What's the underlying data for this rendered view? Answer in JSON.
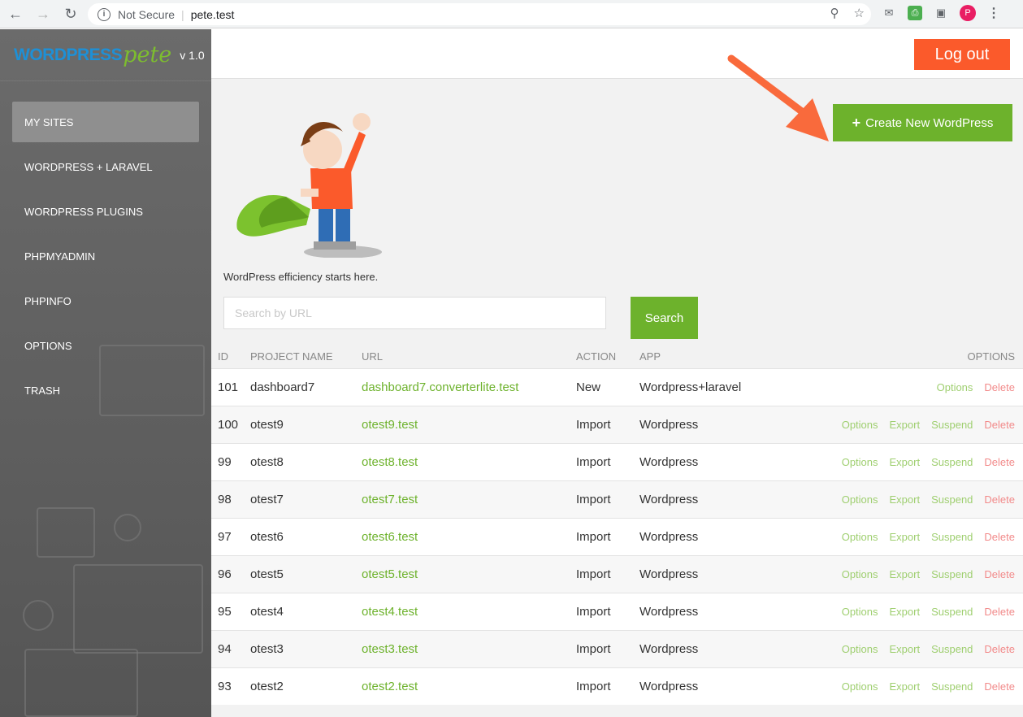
{
  "browser": {
    "security_label": "Not Secure",
    "url": "pete.test",
    "avatar_letter": "P"
  },
  "sidebar": {
    "brand_main": "WORDPRESS",
    "brand_accent": "pete",
    "version": "v 1.0",
    "items": [
      {
        "label": "MY SITES"
      },
      {
        "label": "WORDPRESS + LARAVEL"
      },
      {
        "label": "WORDPRESS PLUGINS"
      },
      {
        "label": "PHPMYADMIN"
      },
      {
        "label": "PHPINFO"
      },
      {
        "label": "OPTIONS"
      },
      {
        "label": "TRASH"
      }
    ]
  },
  "header": {
    "logout_label": "Log out"
  },
  "main": {
    "create_label": "Create New WordPress",
    "tagline": "WordPress efficiency starts here.",
    "search_placeholder": "Search by URL",
    "search_label": "Search"
  },
  "table": {
    "headers": {
      "id": "ID",
      "name": "PROJECT NAME",
      "url": "URL",
      "action": "ACTION",
      "app": "APP",
      "options": "OPTIONS"
    },
    "action_labels": {
      "options": "Options",
      "export": "Export",
      "suspend": "Suspend",
      "delete": "Delete"
    },
    "rows": [
      {
        "id": "101",
        "name": "dashboard7",
        "url": "dashboard7.converterlite.test",
        "action": "New",
        "app": "Wordpress+laravel"
      },
      {
        "id": "100",
        "name": "otest9",
        "url": "otest9.test",
        "action": "Import",
        "app": "Wordpress"
      },
      {
        "id": "99",
        "name": "otest8",
        "url": "otest8.test",
        "action": "Import",
        "app": "Wordpress"
      },
      {
        "id": "98",
        "name": "otest7",
        "url": "otest7.test",
        "action": "Import",
        "app": "Wordpress"
      },
      {
        "id": "97",
        "name": "otest6",
        "url": "otest6.test",
        "action": "Import",
        "app": "Wordpress"
      },
      {
        "id": "96",
        "name": "otest5",
        "url": "otest5.test",
        "action": "Import",
        "app": "Wordpress"
      },
      {
        "id": "95",
        "name": "otest4",
        "url": "otest4.test",
        "action": "Import",
        "app": "Wordpress"
      },
      {
        "id": "94",
        "name": "otest3",
        "url": "otest3.test",
        "action": "Import",
        "app": "Wordpress"
      },
      {
        "id": "93",
        "name": "otest2",
        "url": "otest2.test",
        "action": "Import",
        "app": "Wordpress"
      }
    ]
  },
  "colors": {
    "accent_green": "#6db22c",
    "logout_orange": "#fb5a2b",
    "arrow_orange": "#f96a3c"
  }
}
